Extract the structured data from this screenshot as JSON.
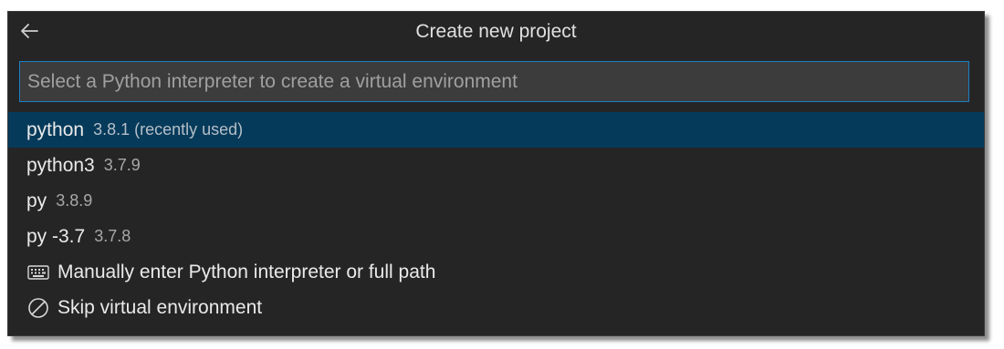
{
  "header": {
    "title": "Create new project",
    "back_icon": "arrow-left-icon"
  },
  "search": {
    "placeholder": "Select a Python interpreter to create a virtual environment",
    "value": ""
  },
  "options": [
    {
      "name": "python",
      "detail": "3.8.1 (recently used)",
      "selected": true
    },
    {
      "name": "python3",
      "detail": "3.7.9",
      "selected": false
    },
    {
      "name": "py",
      "detail": "3.8.9",
      "selected": false
    },
    {
      "name": "py -3.7",
      "detail": "3.7.8",
      "selected": false
    }
  ],
  "actions": [
    {
      "label": "Manually enter Python interpreter or full path",
      "icon": "keyboard-icon"
    },
    {
      "label": "Skip virtual environment",
      "icon": "circle-slash-icon"
    }
  ],
  "colors": {
    "background": "#252526",
    "selected_row": "#063a5a",
    "input_border": "#1b80c4",
    "input_background": "#3c3c3c"
  }
}
